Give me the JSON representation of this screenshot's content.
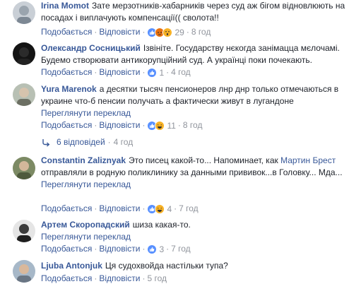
{
  "comments": [
    {
      "author": "Irina Momot",
      "text": "Зате мерзотників-хабарників через суд аж бігом відновлюють на посадах і виплачують компенсації(( сволота!!",
      "like": "Подобається",
      "reply": "Відповісти",
      "reaction_icons": [
        "like-icon",
        "angry-icon",
        "wow-icon"
      ],
      "reaction_count": "29",
      "time": "8 год"
    },
    {
      "author": "Олександр Сосницький",
      "text": "Ізвініте. Государству нєкогда занімацца мєлочамі. Будемо створювати антикорупційний суд. А українці поки почекають.",
      "like": "Подобається",
      "reply": "Відповісти",
      "reaction_icons": [
        "like-icon"
      ],
      "reaction_count": "1",
      "time": "4 год"
    },
    {
      "author": "Yura Marenok",
      "text": "а десятки тысяч пенсионеров лнр днр только отмечаються в украине что-б пенсии получать а фактически живут в лугандоне",
      "translate": "Переглянути переклад",
      "like": "Подобається",
      "reply": "Відповісти",
      "reaction_icons": [
        "like-icon",
        "haha-icon"
      ],
      "reaction_count": "11",
      "time": "8 год",
      "replies_label": "6 відповідей",
      "replies_time": "4 год"
    },
    {
      "author": "Constantin Zaliznyak",
      "text_before": "Это писец какой-то... Напоминает, как",
      "mention": "Мартин Брест",
      "text_after": "отправляли в родную поликлинику за данными прививок...в Головку... Мда...",
      "translate": "Переглянути переклад",
      "like": "Подобається",
      "reply": "Відповісти",
      "reaction_icons": [
        "like-icon",
        "haha-icon"
      ],
      "reaction_count": "4",
      "time": "7 год"
    },
    {
      "author": "Артем Скоропадский",
      "text": "шиза какая-то.",
      "translate": "Переглянути переклад",
      "like": "Подобається",
      "reply": "Відповісти",
      "reaction_icons": [
        "like-icon"
      ],
      "reaction_count": "3",
      "time": "7 год"
    },
    {
      "author": "Ljuba Antonjuk",
      "text": "Ця судохвойда настільки тупа?",
      "like": "Подобається",
      "reply": "Відповісти",
      "time": "5 год"
    }
  ],
  "colors": {
    "link": "#385898",
    "text": "#1d2129",
    "meta": "#90949c",
    "like": "#5890ff",
    "angry": "#e9710f",
    "yellow": "#f7b125"
  }
}
